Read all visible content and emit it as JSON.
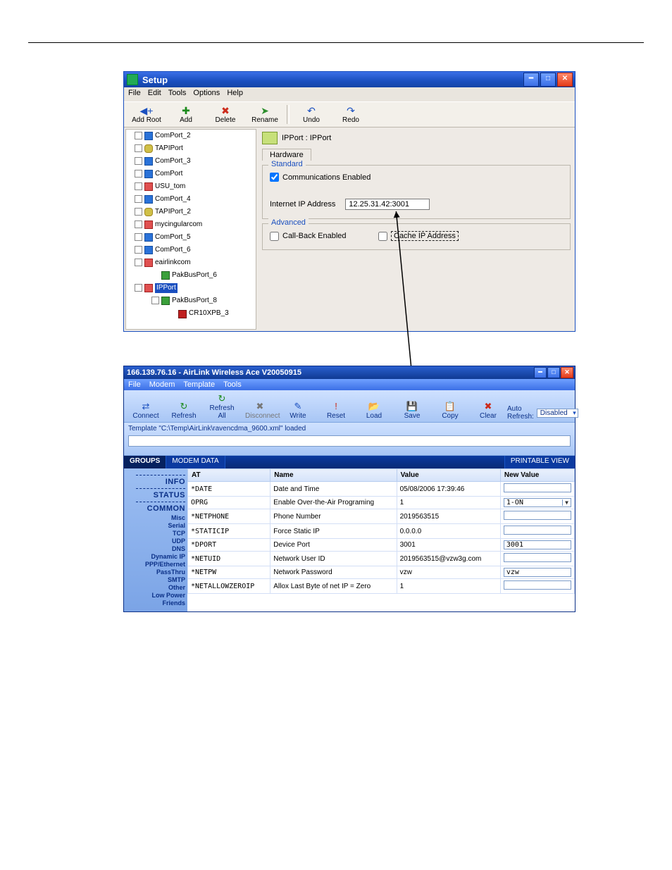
{
  "window1": {
    "title": "Setup",
    "menu": [
      "File",
      "Edit",
      "Tools",
      "Options",
      "Help"
    ],
    "toolbar": [
      {
        "label": "Add Root",
        "glyph": "◀+",
        "cls": "blue"
      },
      {
        "label": "Add",
        "glyph": "✚",
        "cls": "green"
      },
      {
        "label": "Delete",
        "glyph": "✖",
        "cls": "red"
      },
      {
        "label": "Rename",
        "glyph": "➤",
        "cls": "arrow"
      },
      {
        "sep": true
      },
      {
        "label": "Undo",
        "glyph": "↶",
        "cls": "blue"
      },
      {
        "label": "Redo",
        "glyph": "↷",
        "cls": "blue"
      }
    ],
    "tree": [
      {
        "label": "ComPort_2",
        "ic": "ic-com"
      },
      {
        "label": "TAPIPort",
        "ic": "ic-tapi"
      },
      {
        "label": "ComPort_3",
        "ic": "ic-com"
      },
      {
        "label": "ComPort",
        "ic": "ic-com"
      },
      {
        "label": "USU_tom",
        "ic": "ic-ip"
      },
      {
        "label": "ComPort_4",
        "ic": "ic-com"
      },
      {
        "label": "TAPIPort_2",
        "ic": "ic-tapi"
      },
      {
        "label": "mycingularcom",
        "ic": "ic-ip"
      },
      {
        "label": "ComPort_5",
        "ic": "ic-com"
      },
      {
        "label": "ComPort_6",
        "ic": "ic-com"
      },
      {
        "label": "eairlinkcom",
        "ic": "ic-ip",
        "children": [
          {
            "label": "PakBusPort_6",
            "ic": "ic-pak",
            "leaf": true
          }
        ]
      },
      {
        "label": "IPPort",
        "ic": "ic-ip",
        "selected": true,
        "children": [
          {
            "label": "PakBusPort_8",
            "ic": "ic-pak",
            "children": [
              {
                "label": "CR10XPB_3",
                "ic": "ic-dev",
                "leaf": true
              }
            ]
          }
        ]
      }
    ],
    "pane": {
      "heading": "IPPort : IPPort",
      "tab": "Hardware",
      "group1_title": "Standard",
      "comm_label": "Communications Enabled",
      "ipaddr_label": "Internet IP Address",
      "ipaddr_value": "12.25.31.42:3001",
      "group2_title": "Advanced",
      "callback_label": "Call-Back Enabled",
      "cache_label": "Cache IP Address"
    }
  },
  "window2": {
    "title": "166.139.76.16 - AirLink Wireless Ace V20050915",
    "menu": [
      "File",
      "Modem",
      "Template",
      "Tools"
    ],
    "toolbar": [
      {
        "label": "Connect",
        "g": "⇄",
        "cls": "blue"
      },
      {
        "label": "Refresh",
        "g": "↻",
        "cls": "green"
      },
      {
        "label": "Refresh All",
        "g": "↻",
        "cls": "green"
      },
      {
        "label": "Disconnect",
        "g": "✖",
        "cls": "dim"
      },
      {
        "label": "Write",
        "g": "✎",
        "cls": "blue"
      },
      {
        "label": "Reset",
        "g": "!",
        "cls": "red"
      },
      {
        "label": "Load",
        "g": "📂",
        "cls": "blue"
      },
      {
        "label": "Save",
        "g": "💾",
        "cls": "blue"
      },
      {
        "label": "Copy",
        "g": "📋",
        "cls": "blue"
      },
      {
        "label": "Clear",
        "g": "✖",
        "cls": "red"
      }
    ],
    "auto_label": "Auto Refresh:",
    "auto_value": "Disabled",
    "status": "Template \"C:\\Temp\\AirLink\\ravencdma_9600.xml\" loaded",
    "tabs": {
      "left": "GROUPS",
      "mid": "MODEM DATA",
      "right": "PRINTABLE VIEW"
    },
    "groups": [
      {
        "t": "hr"
      },
      {
        "t": "big",
        "v": "INFO"
      },
      {
        "t": "hr"
      },
      {
        "t": "big",
        "v": "STATUS"
      },
      {
        "t": "hr"
      },
      {
        "t": "big",
        "v": "COMMON"
      },
      {
        "t": "sm",
        "v": "Misc"
      },
      {
        "t": "sm",
        "v": "Serial"
      },
      {
        "t": "sm",
        "v": "TCP"
      },
      {
        "t": "sm",
        "v": "UDP"
      },
      {
        "t": "sm",
        "v": "DNS"
      },
      {
        "t": "sm",
        "v": "Dynamic IP"
      },
      {
        "t": "sm",
        "v": "PPP/Ethernet"
      },
      {
        "t": "sm",
        "v": "PassThru"
      },
      {
        "t": "sm",
        "v": "SMTP"
      },
      {
        "t": "sm",
        "v": "Other"
      },
      {
        "t": "sm",
        "v": "Low Power"
      },
      {
        "t": "sm",
        "v": "Friends"
      }
    ],
    "columns": [
      "AT",
      "Name",
      "Value",
      "New Value"
    ],
    "rows": [
      {
        "at": "*DATE",
        "name": "Date and Time",
        "value": "05/08/2006 17:39:46",
        "nv": "",
        "type": "text"
      },
      {
        "at": "OPRG",
        "name": "Enable Over-the-Air Programing",
        "value": "1",
        "nv": "1-ON",
        "type": "select"
      },
      {
        "at": "*NETPHONE",
        "name": "Phone Number",
        "value": "2019563515",
        "nv": "",
        "type": "text"
      },
      {
        "at": "*STATICIP",
        "name": "Force Static IP",
        "value": "0.0.0.0",
        "nv": "",
        "type": "text"
      },
      {
        "at": "*DPORT",
        "name": "Device Port",
        "value": "3001",
        "nv": "3001",
        "type": "text"
      },
      {
        "at": "*NETUID",
        "name": "Network User ID",
        "value": "2019563515@vzw3g.com",
        "nv": "",
        "type": "text"
      },
      {
        "at": "*NETPW",
        "name": "Network Password",
        "value": "vzw",
        "nv": "vzw",
        "type": "text"
      },
      {
        "at": "*NETALLOWZEROIP",
        "name": "Allox Last Byte of net IP = Zero",
        "value": "1",
        "nv": "",
        "type": "text"
      }
    ]
  }
}
